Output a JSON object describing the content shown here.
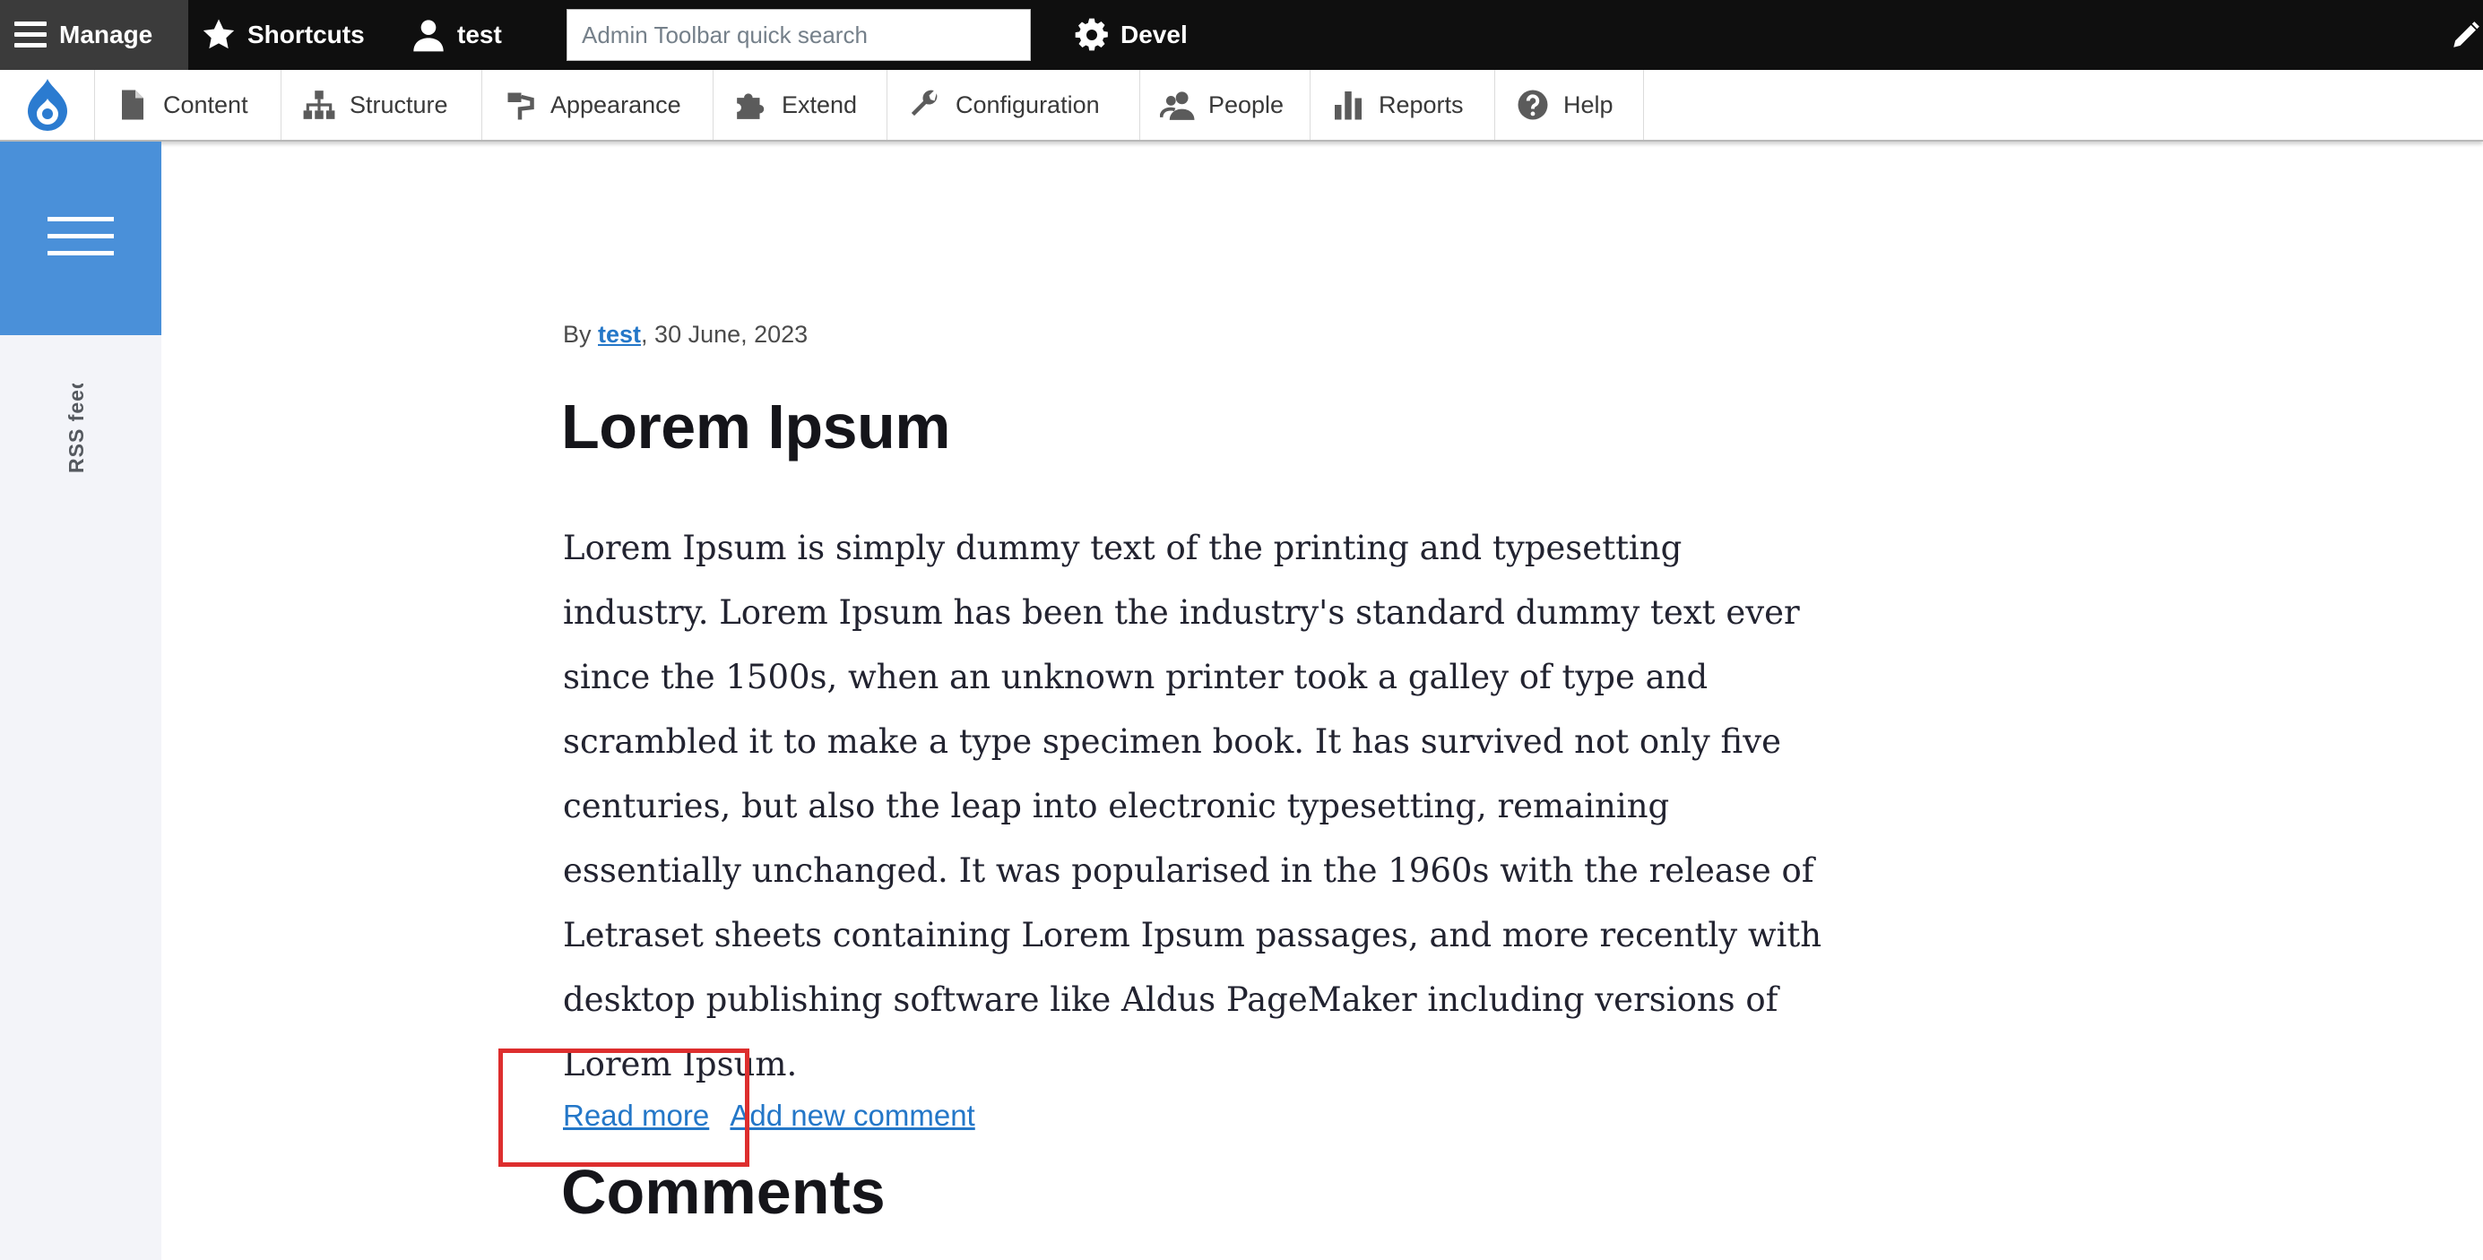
{
  "toolbar": {
    "manage_label": "Manage",
    "shortcuts_label": "Shortcuts",
    "user_label": "test",
    "search_placeholder": "Admin Toolbar quick search",
    "devel_label": "Devel"
  },
  "tray": {
    "items": [
      {
        "label": "Content",
        "icon": "content-icon"
      },
      {
        "label": "Structure",
        "icon": "structure-icon"
      },
      {
        "label": "Appearance",
        "icon": "appearance-icon"
      },
      {
        "label": "Extend",
        "icon": "extend-icon"
      },
      {
        "label": "Configuration",
        "icon": "configuration-icon"
      },
      {
        "label": "People",
        "icon": "people-icon"
      },
      {
        "label": "Reports",
        "icon": "reports-icon"
      },
      {
        "label": "Help",
        "icon": "help-icon"
      }
    ]
  },
  "sidebar": {
    "rss_label": "RSS feed"
  },
  "article": {
    "by_label": "By",
    "author": "test",
    "date": ", 30 June, 2023",
    "title": "Lorem Ipsum",
    "body": "Lorem Ipsum is simply dummy text of the printing and typesetting industry. Lorem Ipsum has been the industry's standard dummy text ever since the 1500s, when an unknown printer took a galley of type and scrambled it to make a type specimen book. It has survived not only five centuries, but also the leap into electronic typesetting, remaining essentially unchanged. It was popularised in the 1960s with the release of Letraset sheets containing Lorem Ipsum passages, and more recently with desktop publishing software like Aldus PageMaker including versions of Lorem Ipsum.",
    "read_more": "Read more",
    "add_comment": "Add new comment"
  },
  "comments": {
    "heading": "Comments"
  },
  "colors": {
    "toolbar_bg": "#0f0f0f",
    "manage_bg": "#3b3b3b",
    "sidebar_accent": "#4a90d9",
    "link": "#2477c8",
    "highlight": "#dd2e2e"
  }
}
